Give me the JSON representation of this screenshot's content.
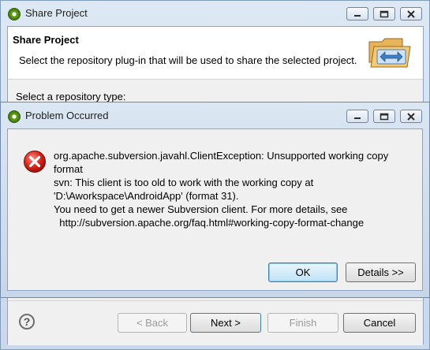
{
  "share_window": {
    "title": "Share Project",
    "header": {
      "title": "Share Project",
      "description": "Select the repository plug-in that will be used to share the selected project."
    },
    "repository_label": "Select a repository type:",
    "buttons": {
      "back": "< Back",
      "next": "Next >",
      "finish": "Finish",
      "cancel": "Cancel"
    }
  },
  "problem_dialog": {
    "title": "Problem Occurred",
    "message_lines": [
      "org.apache.subversion.javahl.ClientException: Unsupported working copy",
      "format",
      "svn: This client is too old to work with the working copy at",
      "'D:\\Aworkspace\\AndroidApp' (format 31).",
      "You need to get a newer Subversion client. For more details, see",
      "  http://subversion.apache.org/faq.html#working-copy-format-change"
    ],
    "buttons": {
      "ok": "OK",
      "details": "Details >>"
    }
  },
  "icons": {
    "app": "eclipse-icon",
    "error": "error-icon",
    "help": "help-icon"
  }
}
